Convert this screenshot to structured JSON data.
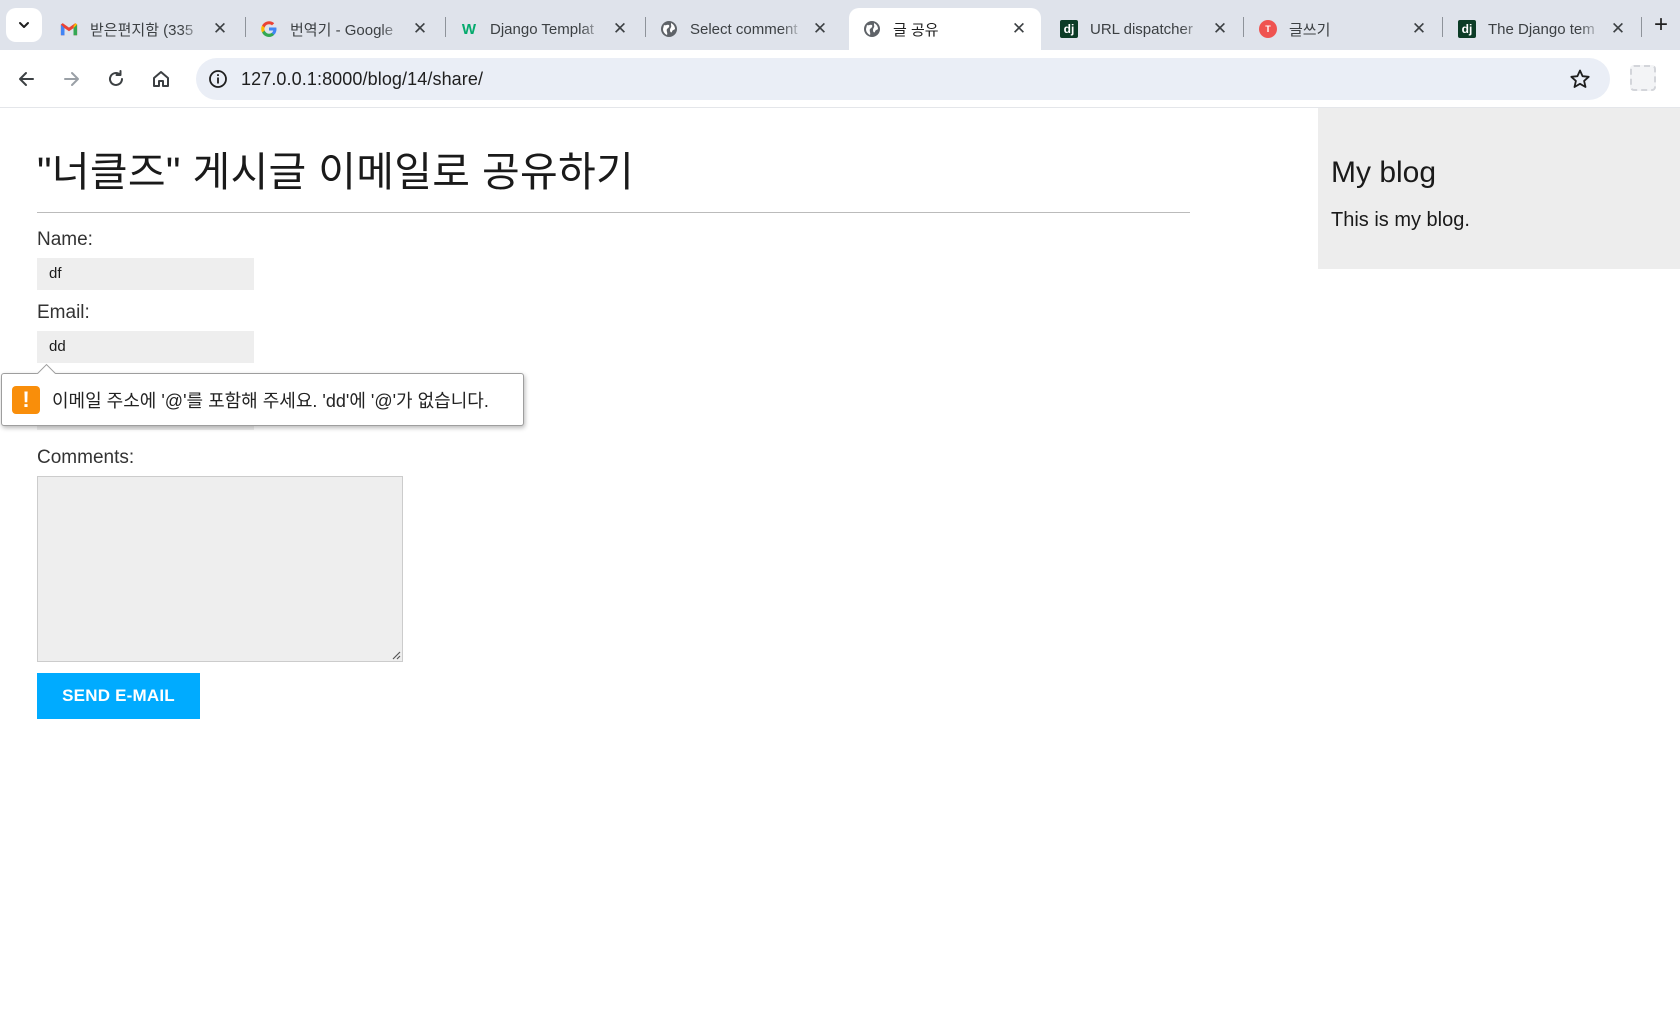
{
  "browser": {
    "tabs": [
      {
        "title": "받은편지함 (335",
        "favicon": "gmail-icon",
        "active": false
      },
      {
        "title": "번역기 - Google",
        "favicon": "google-icon",
        "active": false
      },
      {
        "title": "Django Templat",
        "favicon": "w3schools-icon",
        "active": false
      },
      {
        "title": "Select comment",
        "favicon": "globe-icon",
        "active": false
      },
      {
        "title": "글 공유",
        "favicon": "globe-icon",
        "active": true
      },
      {
        "title": "URL dispatcher",
        "favicon": "django-icon",
        "active": false
      },
      {
        "title": "글쓰기",
        "favicon": "tistory-icon",
        "active": false
      },
      {
        "title": "The Django tem",
        "favicon": "django-icon",
        "active": false
      }
    ],
    "favicon_glyphs": {
      "w3schools": "W",
      "django": "dj",
      "tistory": "T"
    },
    "address_bar": {
      "url": "127.0.0.1:8000/blog/14/share/"
    }
  },
  "page": {
    "title": "\"너클즈\" 게시글 이메일로 공유하기",
    "form": {
      "name_label": "Name:",
      "name_value": "df",
      "email_label": "Email:",
      "email_value": "dd",
      "comments_label": "Comments:",
      "comments_value": "",
      "submit_label": "SEND E-MAIL"
    },
    "validation_message": "이메일 주소에 '@'를 포함해 주세요. 'dd'에 '@'가 없습니다.",
    "sidebar": {
      "title": "My blog",
      "text": "This is my blog."
    }
  },
  "colors": {
    "accent_button": "#00abff",
    "warning": "#f98e0a",
    "tabstrip": "#dfe3eb",
    "sidebar_bg": "#ededed",
    "input_bg": "#eeeeee"
  }
}
